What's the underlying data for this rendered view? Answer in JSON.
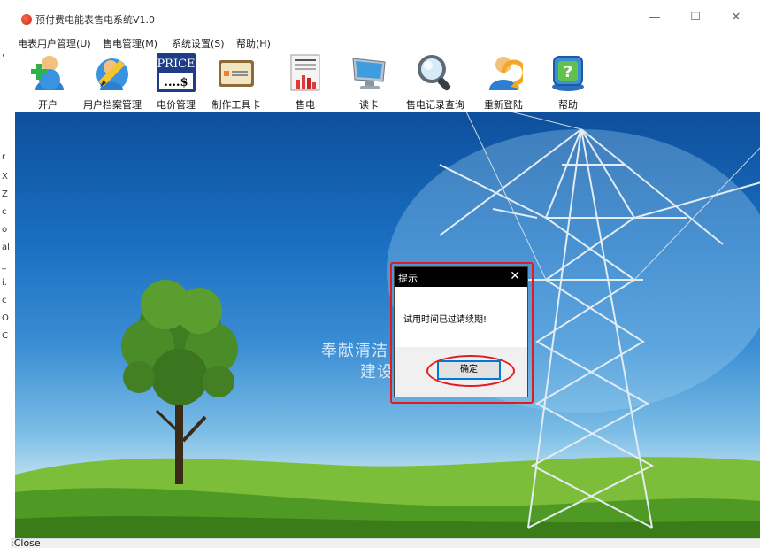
{
  "window": {
    "title": "预付费电能表售电系统V1.0",
    "minimize": "—",
    "maximize": "☐",
    "close": "✕"
  },
  "background_window_chars": [
    "'",
    "r",
    "X",
    "Z",
    "c",
    "o",
    "al",
    "_",
    "i.",
    "c",
    "O",
    "C"
  ],
  "menu": [
    {
      "label": "电表用户管理(U)"
    },
    {
      "label": "售电管理(M)"
    },
    {
      "label": "系统设置(S)"
    },
    {
      "label": "帮助(H)"
    }
  ],
  "toolbar": [
    {
      "label": "开户",
      "icon": "user-add-icon"
    },
    {
      "label": "用户档案管理",
      "icon": "user-edit-icon"
    },
    {
      "label": "电价管理",
      "icon": "price-icon",
      "icon_text_top": "PRICE",
      "icon_text_bottom": "....$"
    },
    {
      "label": "制作工具卡",
      "icon": "card-icon"
    },
    {
      "label": "售电",
      "icon": "sell-document-icon"
    },
    {
      "label": "读卡",
      "icon": "monitor-icon"
    },
    {
      "label": "售电记录查询",
      "icon": "magnifier-icon"
    },
    {
      "label": "重新登陆",
      "icon": "user-relogin-icon"
    },
    {
      "label": "帮助",
      "icon": "help-icon"
    }
  ],
  "slogan": {
    "line1": "奉献清洁",
    "line2": "建设"
  },
  "status": {
    "text": ":Close"
  },
  "dialog": {
    "title": "提示",
    "close": "✕",
    "message": "试用时间已过请续期!",
    "ok_label": "确定"
  },
  "colors": {
    "highlight": "#e41b1b",
    "focus": "#0078d7",
    "dialog_title": "#000000"
  }
}
